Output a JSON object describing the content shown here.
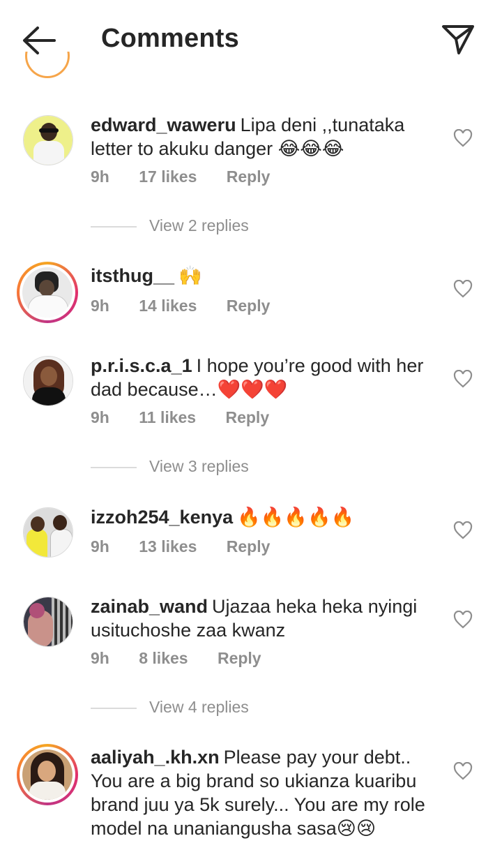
{
  "header": {
    "title": "Comments",
    "back_icon": "arrow-left-icon",
    "send_icon": "paper-plane-icon"
  },
  "comments": [
    {
      "username": "edward_waweru",
      "text": "Lipa deni ,,tunataka letter to akuku danger",
      "emoji": [
        "😂",
        "😂",
        "😂"
      ],
      "time": "9h",
      "likes": "17 likes",
      "reply": "Reply",
      "view_replies": "View 2 replies",
      "story_ring": false
    },
    {
      "username": "itsthug__",
      "text": "",
      "emoji": [
        "🙌"
      ],
      "time": "9h",
      "likes": "14 likes",
      "reply": "Reply",
      "story_ring": true
    },
    {
      "username": "p.r.i.s.c.a_1",
      "text": "I hope you’re good with her dad because…",
      "emoji": [
        "❤️",
        "❤️",
        "❤️"
      ],
      "time": "9h",
      "likes": "11 likes",
      "reply": "Reply",
      "view_replies": "View 3 replies",
      "story_ring": false
    },
    {
      "username": "izzoh254_kenya",
      "text": "",
      "emoji": [
        "🔥",
        "🔥",
        "🔥",
        "🔥",
        "🔥"
      ],
      "time": "9h",
      "likes": "13 likes",
      "reply": "Reply",
      "story_ring": false
    },
    {
      "username": "zainab_wand",
      "text": "Ujazaa heka heka nyingi usituchoshe zaa kwanz",
      "emoji": [],
      "time": "9h",
      "likes": "8 likes",
      "reply": "Reply",
      "view_replies": "View 4 replies",
      "story_ring": false
    },
    {
      "username": "aaliyah_.kh.xn",
      "text": "Please pay your debt.. You are a big brand so ukianza kuaribu brand juu ya 5k surely... You are my role model  na unaniangusha sasa",
      "emoji": [
        "😢",
        "😢"
      ],
      "story_ring": true
    }
  ],
  "colors": {
    "text": "#262626",
    "secondary": "#8e8e8e",
    "divider": "#dbdbdb",
    "story_ring": "#e1306c"
  }
}
